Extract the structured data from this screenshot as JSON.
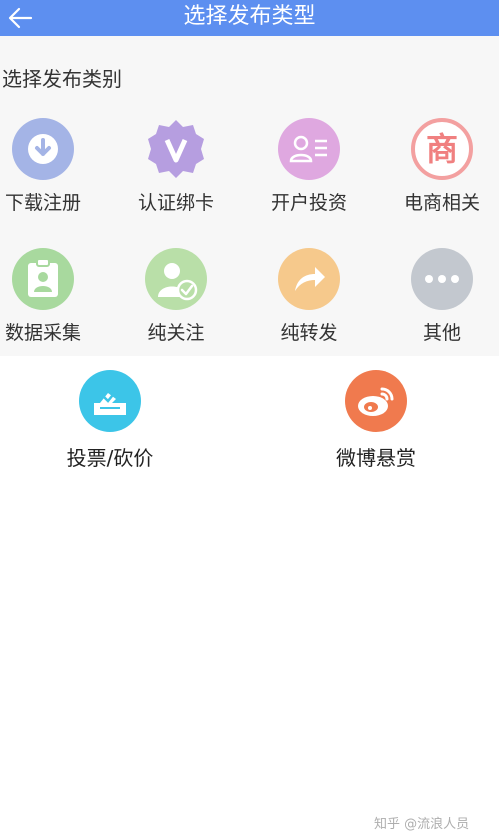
{
  "header": {
    "title": "选择发布类型",
    "back_icon": "back-arrow-icon"
  },
  "section": {
    "title": "选择发布类别"
  },
  "items": [
    {
      "label": "下载注册",
      "icon": "download-icon",
      "color": "#a4b4e6"
    },
    {
      "label": "认证绑卡",
      "icon": "verified-badge-icon",
      "color": "#b69ee0"
    },
    {
      "label": "开户投资",
      "icon": "id-card-icon",
      "color": "#dfa8e0"
    },
    {
      "label": "电商相关",
      "icon": "shop-icon",
      "color": "#f3a0a0"
    },
    {
      "label": "数据采集",
      "icon": "contact-card-icon",
      "color": "#a8d99e"
    },
    {
      "label": "纯关注",
      "icon": "user-check-icon",
      "color": "#b9dfa8"
    },
    {
      "label": "纯转发",
      "icon": "share-arrow-icon",
      "color": "#f6c98c"
    },
    {
      "label": "其他",
      "icon": "more-icon",
      "color": "#c3c8cf"
    }
  ],
  "bottom": [
    {
      "label": "投票/砍价",
      "icon": "vote-box-icon",
      "color": "#3cc5e8"
    },
    {
      "label": "微博悬赏",
      "icon": "weibo-icon",
      "color": "#f07a4e"
    }
  ],
  "watermark": "知乎 @流浪人员"
}
